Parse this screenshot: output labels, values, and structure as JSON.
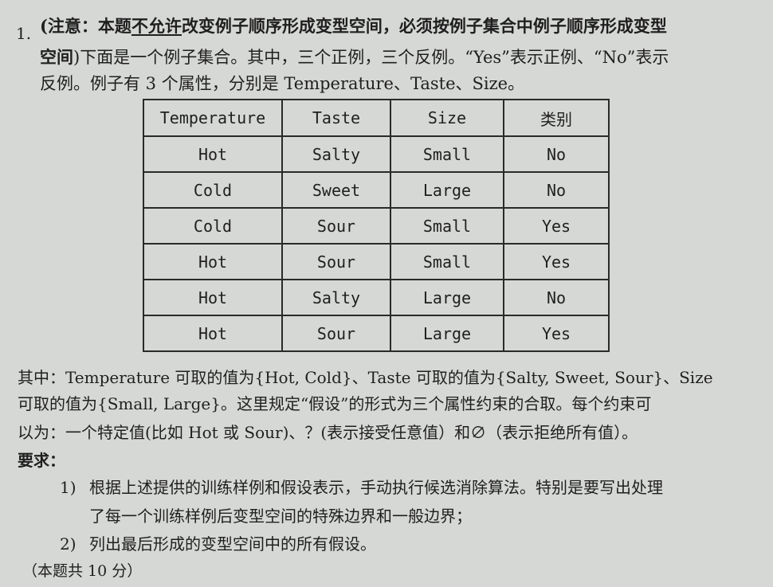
{
  "question": {
    "number": "1.",
    "note_open": "(",
    "note_prefix": "注意：本题",
    "note_underlined": "不允许",
    "note_rest": "改变例子顺序形成变型空间，必须按例子集合中例子顺序形成变型",
    "note_line2": "空间",
    "line2_rest": ")下面是一个例子集合。其中，三个正例，三个反例。“Yes”表示正例、“No”表示",
    "line3": "反例。例子有 3 个属性，分别是 Temperature、Taste、Size。"
  },
  "table": {
    "headers": [
      "Temperature",
      "Taste",
      "Size",
      "类别"
    ],
    "rows": [
      [
        "Hot",
        "Salty",
        "Small",
        "No"
      ],
      [
        "Cold",
        "Sweet",
        "Large",
        "No"
      ],
      [
        "Cold",
        "Sour",
        "Small",
        "Yes"
      ],
      [
        "Hot",
        "Sour",
        "Small",
        "Yes"
      ],
      [
        "Hot",
        "Salty",
        "Large",
        "No"
      ],
      [
        "Hot",
        "Sour",
        "Large",
        "Yes"
      ]
    ]
  },
  "after_table": {
    "line1": "其中：Temperature 可取的值为{Hot, Cold}、Taste 可取的值为{Salty, Sweet, Sour}、Size",
    "line2": "可取的值为{Small, Large}。这里规定“假设”的形式为三个属性约束的合取。每个约束可",
    "line3": "以为：一个特定值(比如 Hot 或 Sour)、？(表示接受任意值）和∅（表示拒绝所有值）。"
  },
  "requirements": {
    "title": "要求：",
    "items": [
      {
        "num": "1)",
        "line1": "根据上述提供的训练样例和假设表示，手动执行候选消除算法。特别是要写出处理",
        "line2": "了每一个训练样例后变型空间的特殊边界和一般边界；"
      },
      {
        "num": "2)",
        "line1": "列出最后形成的变型空间中的所有假设。"
      }
    ],
    "score": "（本题共 10 分）"
  }
}
